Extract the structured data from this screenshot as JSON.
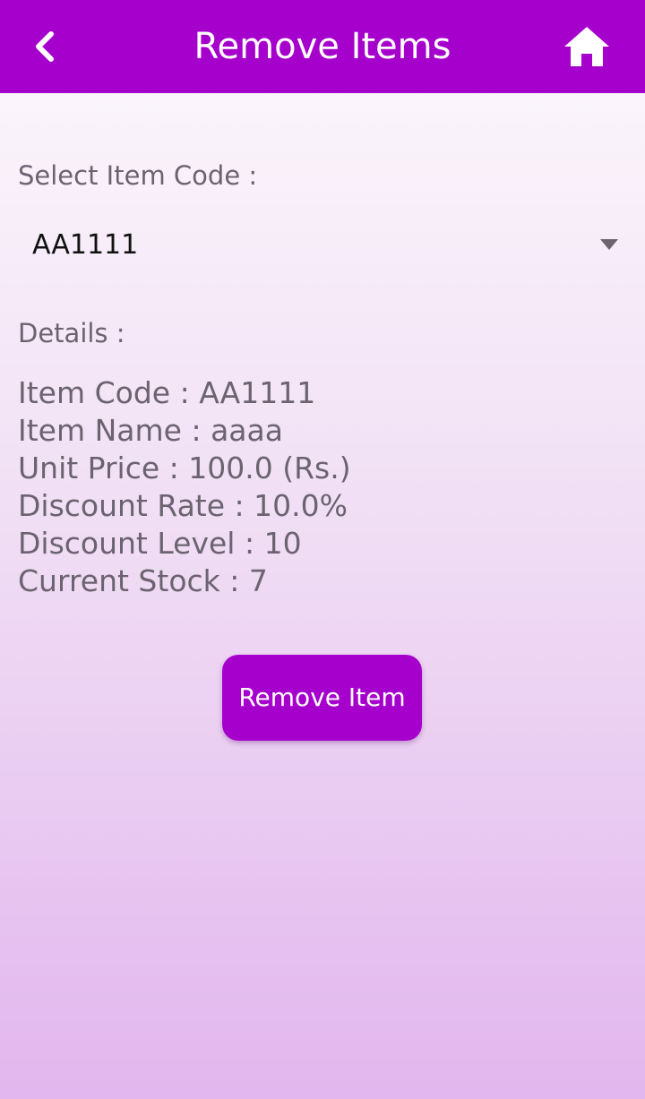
{
  "app_bar": {
    "title": "Remove Items",
    "back_icon": "chevron-left-icon",
    "home_icon": "home-icon",
    "color": "#a600cc"
  },
  "form": {
    "select_label": "Select Item Code :",
    "selected_code": "AA1111",
    "dropdown_icon": "triangle-down-icon",
    "details_label": "Details :"
  },
  "details": {
    "item_code": "Item Code : AA1111",
    "item_name": "Item Name : aaaa",
    "unit_price": "Unit Price : 100.0 (Rs.)",
    "discount_rate": "Discount Rate : 10.0%",
    "discount_level": "Discount Level : 10",
    "current_stock": "Current Stock : 7"
  },
  "actions": {
    "remove_label": "Remove Item",
    "button_color": "#a600cc"
  }
}
